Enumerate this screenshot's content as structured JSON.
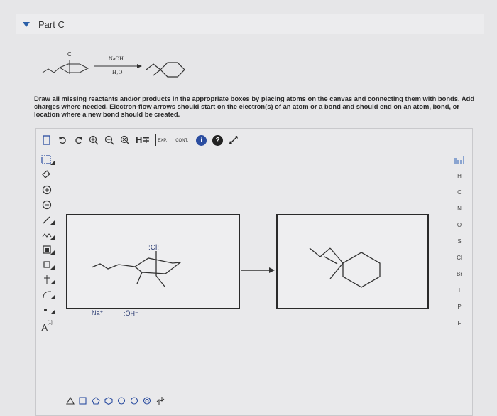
{
  "part": {
    "title": "Part C"
  },
  "reaction": {
    "chlorine_label": "Cl",
    "reagent_top": "NaOH",
    "reagent_bottom": "H₂O"
  },
  "instructions": {
    "text": "Draw all missing reactants and/or products in the appropriate boxes by placing atoms on the canvas and connecting them with bonds. Add charges where needed. Electron-flow arrows should start on the electron(s) of an atom or a bond and should end on an atom, bond, or location where a new bond should be created."
  },
  "toolbar": {
    "h_label": "H∓",
    "exp_label": "EXP.",
    "cont_label": "CONT.",
    "info_label": "i",
    "help_label": "?"
  },
  "left_tools": {
    "atom_label": "A",
    "atom_superscript": "[1]"
  },
  "elements": [
    "H",
    "C",
    "N",
    "O",
    "S",
    "Cl",
    "Br",
    "I",
    "P",
    "F"
  ],
  "canvas": {
    "reactant_cl": ":Cl:",
    "sodium": "Na⁺",
    "hydroxide": ":ÖH⁻"
  },
  "colors": {
    "accent": "#2a5fa8",
    "box_border": "#2a2a2a",
    "toolbar_blue": "#2b4da0"
  }
}
